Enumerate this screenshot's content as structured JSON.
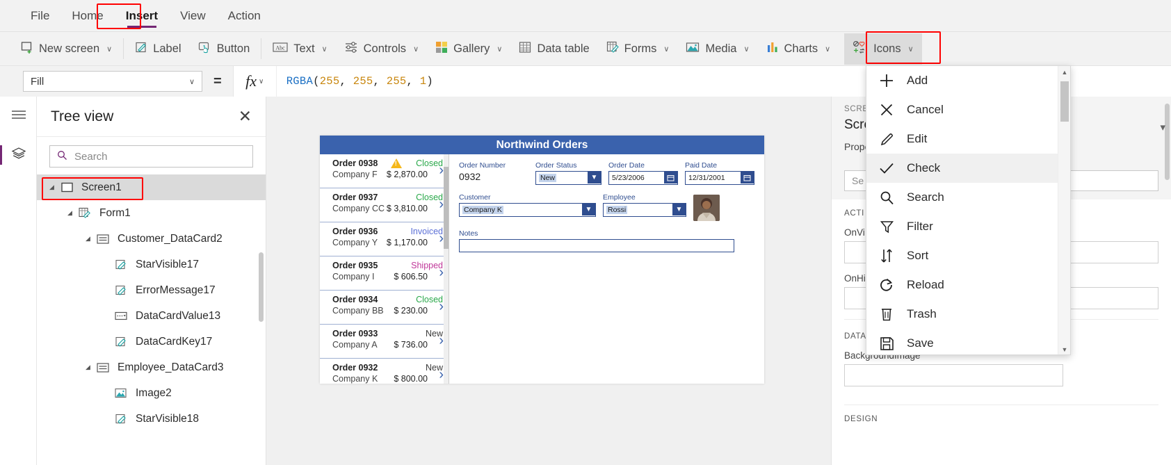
{
  "menubar": {
    "items": [
      {
        "label": "File",
        "active": false
      },
      {
        "label": "Home",
        "active": false
      },
      {
        "label": "Insert",
        "active": true
      },
      {
        "label": "View",
        "active": false
      },
      {
        "label": "Action",
        "active": false
      }
    ]
  },
  "ribbon": {
    "items": [
      {
        "label": "New screen",
        "icon": "new-screen-icon",
        "caret": "∨"
      },
      {
        "label": "Label",
        "icon": "label-icon",
        "caret": ""
      },
      {
        "label": "Button",
        "icon": "button-icon",
        "caret": ""
      },
      {
        "label": "Text",
        "icon": "text-icon",
        "caret": "∨"
      },
      {
        "label": "Controls",
        "icon": "controls-icon",
        "caret": "∨"
      },
      {
        "label": "Gallery",
        "icon": "gallery-icon",
        "caret": "∨"
      },
      {
        "label": "Data table",
        "icon": "data-table-icon",
        "caret": ""
      },
      {
        "label": "Forms",
        "icon": "forms-icon",
        "caret": "∨"
      },
      {
        "label": "Media",
        "icon": "media-icon",
        "caret": "∨"
      },
      {
        "label": "Charts",
        "icon": "charts-icon",
        "caret": "∨"
      },
      {
        "label": "Icons",
        "icon": "icons-icon",
        "caret": "∨"
      }
    ]
  },
  "formula_bar": {
    "property": "Fill",
    "equals": "=",
    "fx": "fx",
    "chevron": "∨",
    "formula_fn": "RGBA",
    "formula_open": "(",
    "formula_args": [
      "255",
      "255",
      "255",
      "1"
    ],
    "formula_close": ")",
    "formula_comma": ", "
  },
  "tree_view": {
    "title": "Tree view",
    "close": "✕",
    "search_placeholder": "Search",
    "items": [
      {
        "label": "Screen1",
        "depth": 0,
        "caret": "◢",
        "icon": "screen-icon",
        "selected": true
      },
      {
        "label": "Form1",
        "depth": 1,
        "caret": "◢",
        "icon": "form-icon",
        "selected": false
      },
      {
        "label": "Customer_DataCard2",
        "depth": 2,
        "caret": "◢",
        "icon": "datacard-icon",
        "selected": false
      },
      {
        "label": "StarVisible17",
        "depth": 3,
        "caret": "",
        "icon": "label-icon",
        "selected": false
      },
      {
        "label": "ErrorMessage17",
        "depth": 3,
        "caret": "",
        "icon": "label-icon",
        "selected": false
      },
      {
        "label": "DataCardValue13",
        "depth": 3,
        "caret": "",
        "icon": "dropdown-icon",
        "selected": false
      },
      {
        "label": "DataCardKey17",
        "depth": 3,
        "caret": "",
        "icon": "label-icon",
        "selected": false
      },
      {
        "label": "Employee_DataCard3",
        "depth": 2,
        "caret": "◢",
        "icon": "datacard-icon",
        "selected": false
      },
      {
        "label": "Image2",
        "depth": 3,
        "caret": "",
        "icon": "image-icon",
        "selected": false
      },
      {
        "label": "StarVisible18",
        "depth": 3,
        "caret": "",
        "icon": "label-icon",
        "selected": false
      }
    ]
  },
  "canvas": {
    "app_title": "Northwind Orders",
    "gallery": [
      {
        "order": "Order 0938",
        "company": "Company F",
        "status": "Closed",
        "amount": "$ 2,870.00",
        "warning": true
      },
      {
        "order": "Order 0937",
        "company": "Company CC",
        "status": "Closed",
        "amount": "$ 3,810.00",
        "warning": false
      },
      {
        "order": "Order 0936",
        "company": "Company Y",
        "status": "Invoiced",
        "amount": "$ 1,170.00",
        "warning": false
      },
      {
        "order": "Order 0935",
        "company": "Company I",
        "status": "Shipped",
        "amount": "$ 606.50",
        "warning": false
      },
      {
        "order": "Order 0934",
        "company": "Company BB",
        "status": "Closed",
        "amount": "$ 230.00",
        "warning": false
      },
      {
        "order": "Order 0933",
        "company": "Company A",
        "status": "New",
        "amount": "$ 736.00",
        "warning": false
      },
      {
        "order": "Order 0932",
        "company": "Company K",
        "status": "New",
        "amount": "$ 800.00",
        "warning": false
      }
    ],
    "form": {
      "order_number_label": "Order Number",
      "order_number_value": "0932",
      "order_status_label": "Order Status",
      "order_status_value": "New",
      "order_date_label": "Order Date",
      "order_date_value": "5/23/2006",
      "paid_date_label": "Paid Date",
      "paid_date_value": "12/31/2001",
      "customer_label": "Customer",
      "customer_value": "Company K",
      "employee_label": "Employee",
      "employee_value": "Rossi",
      "notes_label": "Notes",
      "notes_value": ""
    }
  },
  "properties_panel": {
    "caption": "SCREEN",
    "title": "Scre",
    "subtitle": "Prope",
    "search_value": "Se",
    "actions_caption": "ACTI",
    "field1_label": "OnVi",
    "field2_label": "OnHi",
    "data_caption": "DATA",
    "background_image_label": "BackgroundImage",
    "background_image_value": "",
    "design_caption": "DESIGN"
  },
  "icons_menu": {
    "items": [
      {
        "label": "Add",
        "icon": "plus-icon",
        "highlighted": false
      },
      {
        "label": "Cancel",
        "icon": "x-icon",
        "highlighted": false
      },
      {
        "label": "Edit",
        "icon": "pencil-icon",
        "highlighted": false
      },
      {
        "label": "Check",
        "icon": "check-icon",
        "highlighted": true
      },
      {
        "label": "Search",
        "icon": "search-icon",
        "highlighted": false
      },
      {
        "label": "Filter",
        "icon": "funnel-icon",
        "highlighted": false
      },
      {
        "label": "Sort",
        "icon": "sort-icon",
        "highlighted": false
      },
      {
        "label": "Reload",
        "icon": "reload-icon",
        "highlighted": false
      },
      {
        "label": "Trash",
        "icon": "trash-icon",
        "highlighted": false
      },
      {
        "label": "Save",
        "icon": "save-icon",
        "highlighted": false
      }
    ],
    "scroll_up": "▲",
    "scroll_down": "▼"
  },
  "colors": {
    "accent_purple": "#742774",
    "highlight_red": "#ff0000",
    "app_header_blue": "#3a62ad",
    "status_closed": "#2aa84a",
    "status_invoiced": "#5b6fd6",
    "status_shipped": "#c0389a",
    "status_new": "#3b3b3b"
  }
}
